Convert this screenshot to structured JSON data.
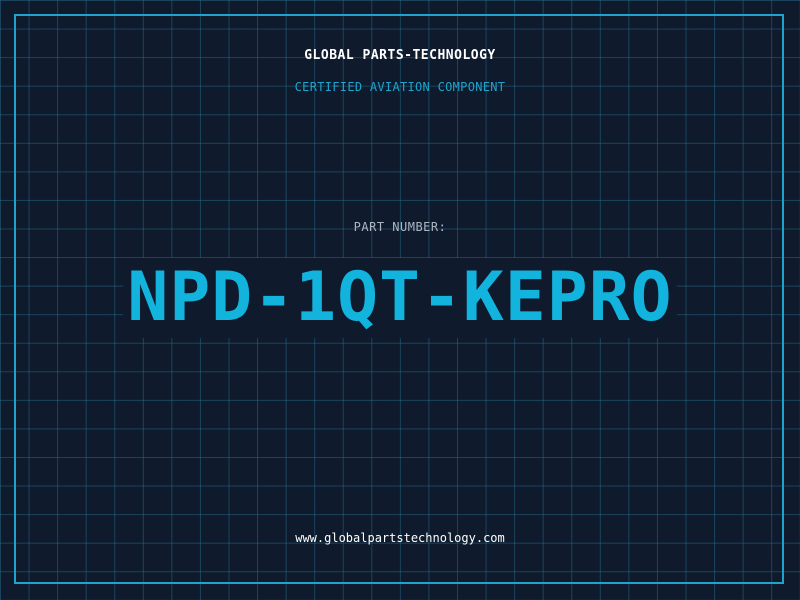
{
  "header": {
    "company_name": "GLOBAL PARTS-TECHNOLOGY",
    "subtitle": "CERTIFIED AVIATION COMPONENT"
  },
  "part": {
    "label": "PART NUMBER:",
    "number": "NPD-1QT-KEPRO"
  },
  "footer": {
    "url": "www.globalpartstechnology.com"
  },
  "colors": {
    "background": "#0f1a2d",
    "accent": "#12b4dd",
    "border": "#1fa3cc",
    "text_primary": "#ffffff",
    "text_muted": "#aeb6c2"
  }
}
